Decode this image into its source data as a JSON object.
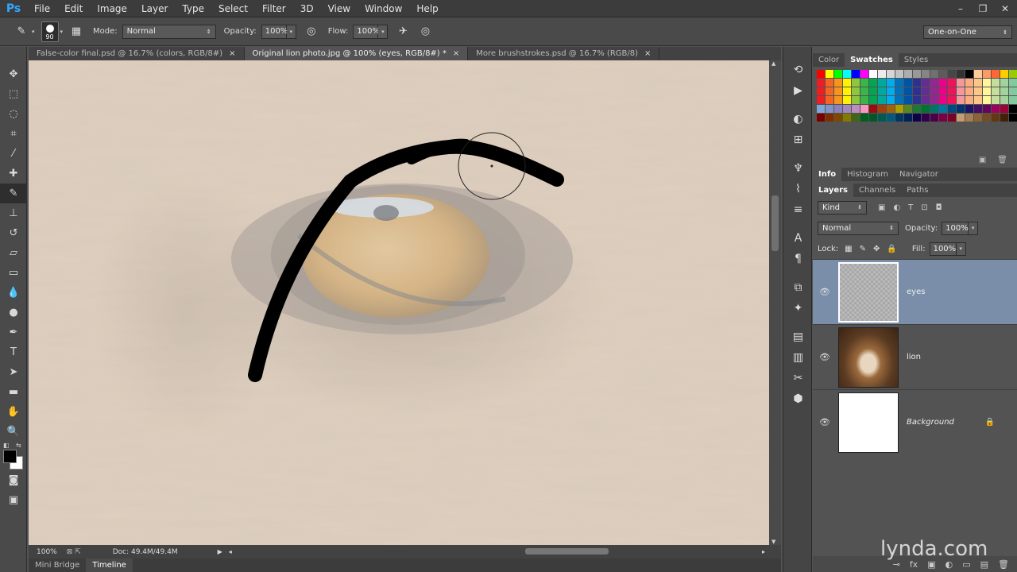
{
  "app": {
    "logo": "Ps"
  },
  "menu": [
    "File",
    "Edit",
    "Image",
    "Layer",
    "Type",
    "Select",
    "Filter",
    "3D",
    "View",
    "Window",
    "Help"
  ],
  "window_controls": [
    "–",
    "❐",
    "✕"
  ],
  "options": {
    "brush_size": "90",
    "mode_label": "Mode:",
    "mode_value": "Normal",
    "opacity_label": "Opacity:",
    "opacity_value": "100%",
    "flow_label": "Flow:",
    "flow_value": "100%"
  },
  "workspace": {
    "value": "One-on-One"
  },
  "tabs": [
    {
      "label": "False-color final.psd @ 16.7% (colors, RGB/8#)",
      "close": "×"
    },
    {
      "label": "Original lion photo.jpg @ 100% (eyes, RGB/8#) *",
      "close": "×"
    },
    {
      "label": "More brushstrokes.psd @ 16.7% (RGB/8)",
      "close": "×"
    }
  ],
  "status": {
    "zoom": "100%",
    "doc": "Doc: 49.4M/49.4M"
  },
  "bottom_tabs": [
    "Mini Bridge",
    "Timeline"
  ],
  "swatch_panel": {
    "tabs": [
      "Color",
      "Swatches",
      "Styles"
    ]
  },
  "info_panel": {
    "tabs": [
      "Info",
      "Histogram",
      "Navigator"
    ]
  },
  "layers_panel": {
    "tabs": [
      "Layers",
      "Channels",
      "Paths"
    ],
    "filter_kind": "Kind",
    "blend_mode": "Normal",
    "opacity_label": "Opacity:",
    "opacity_value": "100%",
    "lock_label": "Lock:",
    "fill_label": "Fill:",
    "fill_value": "100%",
    "layers": [
      {
        "name": "eyes",
        "selected": true
      },
      {
        "name": "lion",
        "selected": false
      },
      {
        "name": "Background",
        "selected": false
      }
    ]
  },
  "watermark": "lynda.com"
}
